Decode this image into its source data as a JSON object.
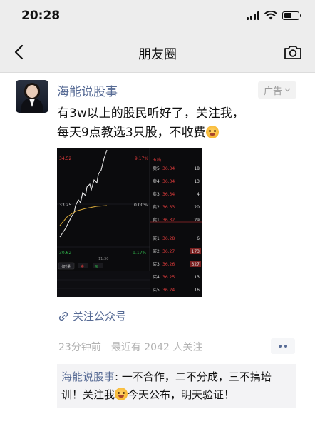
{
  "status_bar": {
    "time": "20:28",
    "battery_level": 0.55
  },
  "nav": {
    "title": "朋友圈",
    "back_icon": "chevron-left-icon",
    "camera_icon": "camera-icon"
  },
  "post": {
    "author": "海能说股事",
    "ad_label": "广告",
    "text_line1": "有3w以上的股民听好了，关注我，",
    "text_line2": "每天9点教选3只股，不收费",
    "follow_link": "关注公众号",
    "time": "23分钟前",
    "followers": "最近有 2042 人关注",
    "stock_image": {
      "top_left": "34.52",
      "top_pct": "+9.17%",
      "mid_price": "33.25",
      "mid_pct": "0.00%",
      "low_price": "30.62",
      "low_pct": "-9.17%",
      "time_label": "11:30",
      "sell_label": "卖",
      "buy_label": "买",
      "tab_label": "分时量",
      "order_rows": [
        {
          "label": "卖5",
          "price": "36.34",
          "vol": "18"
        },
        {
          "label": "卖4",
          "price": "36.34",
          "vol": "13"
        },
        {
          "label": "卖3",
          "price": "36.34",
          "vol": "4"
        },
        {
          "label": "卖2",
          "price": "36.33",
          "vol": "20"
        },
        {
          "label": "卖1",
          "price": "36.32",
          "vol": "29"
        },
        {
          "label": "买1",
          "price": "36.28",
          "vol": "6"
        },
        {
          "label": "买2",
          "price": "36.27",
          "vol": "173"
        },
        {
          "label": "买3",
          "price": "36.26",
          "vol": "327"
        },
        {
          "label": "买4",
          "price": "36.25",
          "vol": "13"
        },
        {
          "label": "买5",
          "price": "36.24",
          "vol": "16"
        }
      ],
      "header": "五档"
    }
  },
  "comment": {
    "author": "海能说股事",
    "text_part1": ": 一不合作，二不分成，三不搞培训！关注我",
    "text_part2": "今天公布，明天验证！"
  },
  "colors": {
    "link": "#576b95",
    "up": "#e03b3b",
    "down": "#2fb14a"
  }
}
